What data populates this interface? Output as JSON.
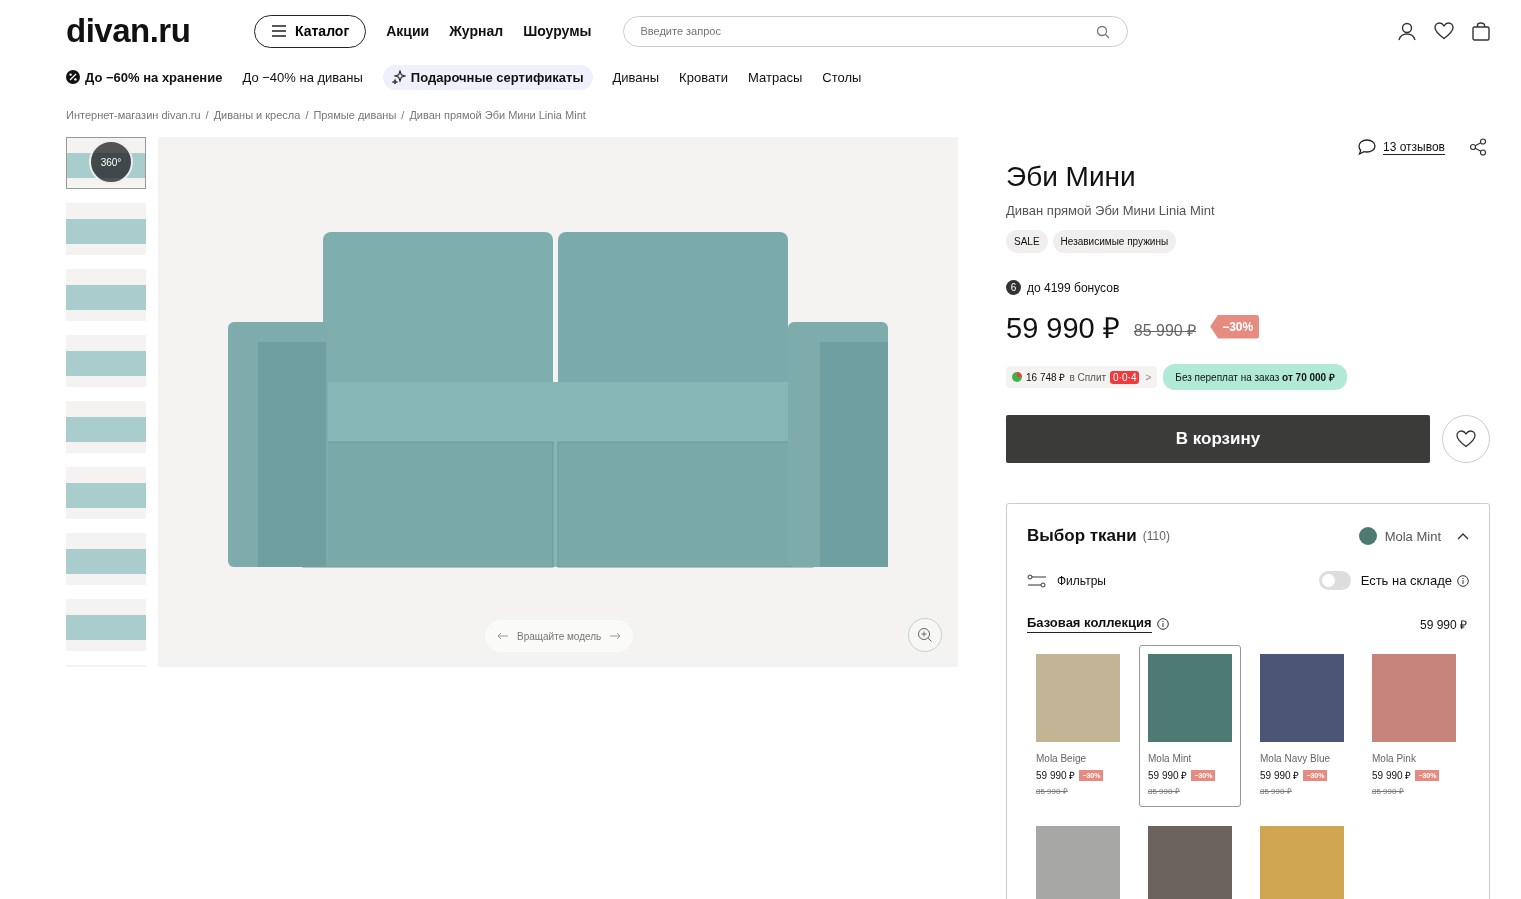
{
  "header": {
    "logo": "divan.ru",
    "catalog_button": "Каталог",
    "links": [
      "Акции",
      "Журнал",
      "Шоурумы"
    ],
    "search": {
      "placeholder": "Введите запрос"
    }
  },
  "nav": [
    {
      "label": "До −60% на хранение",
      "kind": "promo"
    },
    {
      "label": "До −40% на диваны",
      "kind": "plain"
    },
    {
      "label": "Подарочные сертификаты",
      "kind": "highlight"
    },
    {
      "label": "Диваны",
      "kind": "plain"
    },
    {
      "label": "Кровати",
      "kind": "plain"
    },
    {
      "label": "Матрасы",
      "kind": "plain"
    },
    {
      "label": "Столы",
      "kind": "plain"
    }
  ],
  "breadcrumb_separator": "/",
  "breadcrumbs": [
    "Интернет-магазин divan.ru",
    "Диваны и кресла",
    "Прямые диваны",
    "Диван прямой Эби Мини Linia Mint"
  ],
  "gallery": {
    "thumbnails": [
      {
        "selected": true,
        "badge": "360°"
      },
      {
        "selected": false
      },
      {
        "selected": false
      },
      {
        "selected": false
      },
      {
        "selected": false
      },
      {
        "selected": false
      },
      {
        "selected": false
      },
      {
        "selected": false
      },
      {
        "selected": false
      }
    ],
    "rotate_hint": "Вращайте модель"
  },
  "product": {
    "reviews": "13 отзывов",
    "title": "Эби Мини",
    "subtitle": "Диван прямой Эби Мини Linia Mint",
    "tags": [
      "SALE",
      "Независимые пружины"
    ],
    "bonus_badge": "6",
    "bonus": "до 4199 бонусов",
    "price": "59 990 ₽",
    "old_price": "85 990 ₽",
    "discount": "−30%",
    "split": {
      "amount": "16 748 ₽",
      "label": "в Сплит",
      "badge": "0·0·4",
      "chevron": ">"
    },
    "promo": "Без переплат на заказ **от 70 000 ₽**",
    "cart_button": "В корзину"
  },
  "fabric": {
    "title": "Выбор ткани",
    "count": "(110)",
    "current": {
      "name": "Mola Mint",
      "color": "#4f7a72"
    },
    "expanded": true,
    "filters": "Фильтры",
    "stock": {
      "label": "Есть на складе",
      "on": false
    },
    "collection": "Базовая коллекция",
    "collection_price": "59 990 ₽",
    "swatches": [
      {
        "name": "Mola Beige",
        "color": "#c2b495",
        "price": "59 990 ₽",
        "discount": "−30%",
        "old_price": "85 990 ₽",
        "selected": false
      },
      {
        "name": "Mola Mint",
        "color": "#4d7a72",
        "price": "59 990 ₽",
        "discount": "−30%",
        "old_price": "85 990 ₽",
        "selected": true
      },
      {
        "name": "Mola Navy Blue",
        "color": "#4b5677",
        "price": "59 990 ₽",
        "discount": "−30%",
        "old_price": "85 990 ₽",
        "selected": false
      },
      {
        "name": "Mola Pink",
        "color": "#c7847d",
        "price": "59 990 ₽",
        "discount": "−30%",
        "old_price": "85 990 ₽",
        "selected": false
      },
      {
        "color": "#a7a7a5",
        "selected": false
      },
      {
        "color": "#6c635d",
        "selected": false
      },
      {
        "color": "#cfa552",
        "selected": false
      }
    ]
  }
}
